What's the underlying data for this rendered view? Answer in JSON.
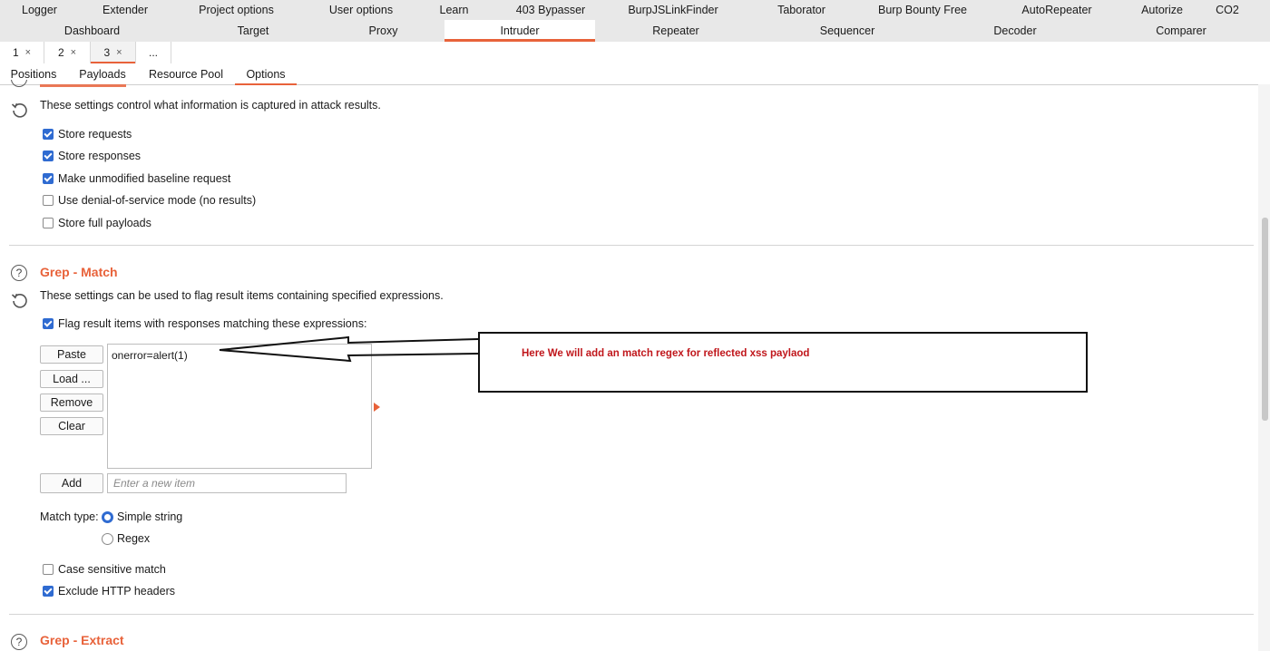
{
  "top_tabs_row1": [
    "Logger",
    "Extender",
    "Project options",
    "User options",
    "Learn",
    "403 Bypasser",
    "BurpJSLinkFinder",
    "Taborator",
    "Burp Bounty Free",
    "AutoRepeater",
    "Autorize",
    "CO2"
  ],
  "top_tabs_row2": [
    "Dashboard",
    "Target",
    "Proxy",
    "Intruder",
    "Repeater",
    "Sequencer",
    "Decoder",
    "Comparer"
  ],
  "active_top_tab": "Intruder",
  "sub_tabs": [
    "1",
    "2",
    "3",
    "..."
  ],
  "close_glyph": "×",
  "panel_tabs": [
    "Positions",
    "Payloads",
    "Resource Pool",
    "Options"
  ],
  "active_panel_tab": "Options",
  "attack_results": {
    "description": "These settings control what information is captured in attack results.",
    "options": [
      {
        "label": "Store requests",
        "checked": true
      },
      {
        "label": "Store responses",
        "checked": true
      },
      {
        "label": "Make unmodified baseline request",
        "checked": true
      },
      {
        "label": "Use denial-of-service mode (no results)",
        "checked": false
      },
      {
        "label": "Store full payloads",
        "checked": false
      }
    ]
  },
  "grep_match": {
    "title": "Grep - Match",
    "description": "These settings can be used to flag result items containing specified expressions.",
    "flag_label": "Flag result items with responses matching these expressions:",
    "flag_checked": true,
    "buttons": {
      "paste": "Paste",
      "load": "Load ...",
      "remove": "Remove",
      "clear": "Clear",
      "add": "Add"
    },
    "items": [
      "onerror=alert(1)"
    ],
    "new_item_placeholder": "Enter a new item",
    "match_type_label": "Match type:",
    "match_types": [
      {
        "label": "Simple string",
        "selected": true
      },
      {
        "label": "Regex",
        "selected": false
      }
    ],
    "case_sensitive": {
      "label": "Case sensitive match",
      "checked": false
    },
    "exclude_headers": {
      "label": "Exclude HTTP headers",
      "checked": true
    }
  },
  "grep_extract": {
    "title": "Grep - Extract"
  },
  "annotation": {
    "text": "Here We will add an match  regex for reflected xss paylaod"
  },
  "colors": {
    "accent": "#e8623a",
    "checkbox": "#2f6bd1",
    "annotation_text": "#c0161b"
  }
}
